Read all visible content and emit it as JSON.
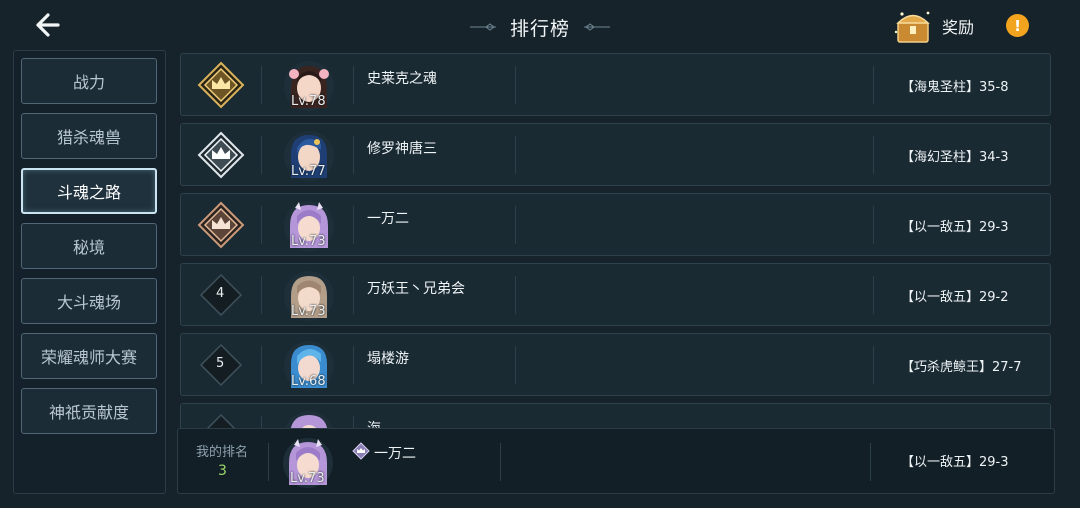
{
  "header": {
    "title": "排行榜",
    "reward_label": "奖励",
    "info_glyph": "!"
  },
  "sidebar": {
    "tabs": [
      {
        "label": "战力"
      },
      {
        "label": "猎杀魂兽"
      },
      {
        "label": "斗魂之路"
      },
      {
        "label": "秘境"
      },
      {
        "label": "大斗魂场"
      },
      {
        "label": "荣耀魂师大赛"
      },
      {
        "label": "神祇贡献度"
      }
    ],
    "active_index": 2
  },
  "rows": [
    {
      "rank": "1",
      "badge": "gold-crown-badge",
      "lv": "Lv.78",
      "name": "史莱克之魂",
      "team": "【海鬼圣柱】35-8"
    },
    {
      "rank": "2",
      "badge": "silver-crown-badge",
      "lv": "Lv.77",
      "name": "修罗神唐三",
      "team": "【海幻圣柱】34-3"
    },
    {
      "rank": "3",
      "badge": "bronze-crown-badge",
      "lv": "Lv.73",
      "name": "一万二",
      "team": "【以一敌五】29-3"
    },
    {
      "rank": "4",
      "badge": "",
      "lv": "Lv.73",
      "name": "万妖王丶兄弟会",
      "team": "【以一敌五】29-2"
    },
    {
      "rank": "5",
      "badge": "",
      "lv": "Lv.68",
      "name": "塌楼游",
      "team": "【巧杀虎鲸王】27-7"
    },
    {
      "rank": "",
      "badge": "",
      "lv": "",
      "name": "海",
      "team": ""
    }
  ],
  "my_rank": {
    "label": "我的排名",
    "rank": "3",
    "lv": "Lv.73",
    "name": "一万二",
    "team": "【以一敌五】29-3"
  },
  "colors": {
    "background": "#16232b",
    "gold": "#d8b25a",
    "silver": "#dfe6ea",
    "bronze": "#c9997a",
    "info": "#f2a41e",
    "my_rank_number": "#9ad86a"
  }
}
